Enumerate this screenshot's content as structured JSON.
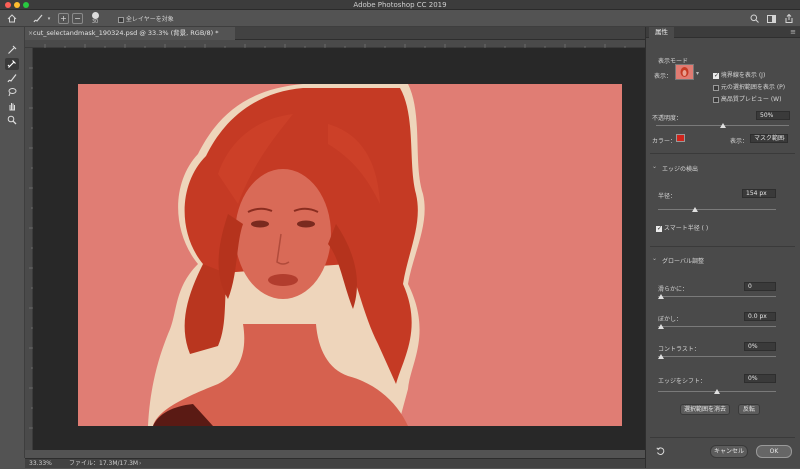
{
  "window": {
    "title": "Adobe Photoshop CC 2019"
  },
  "options_bar": {
    "brush_size": "30",
    "sample_all_layers": "全レイヤーを対象"
  },
  "document_tab": {
    "label": "cut_selectandmask_190324.psd @ 33.3% (背景, RGB/8) *"
  },
  "status_bar": {
    "zoom": "33.33%",
    "file_info": "ファイル：17.3M/17.3M"
  },
  "panel": {
    "tab": "属性",
    "view_mode": {
      "title": "表示モード",
      "view_label": "表示：",
      "show_edge": "境界線を表示 (J)",
      "show_original": "元の選択範囲を表示 (P)",
      "high_quality": "高品質プレビュー (W)"
    },
    "opacity": {
      "label": "不透明度：",
      "value": "50%",
      "level": 0.5
    },
    "color": {
      "label": "カラー：",
      "swatch": "#d0241b"
    },
    "display": {
      "label": "表示：",
      "value": "マスク範囲"
    },
    "edge_detection": {
      "title": "エッジの検出",
      "radius_label": "半径：",
      "radius_value": "154 px",
      "radius_level": 0.31,
      "smart_radius": "スマート半径 ( )"
    },
    "global_refinements": {
      "title": "グローバル調整",
      "smooth_label": "滑らかに：",
      "smooth_value": "0",
      "feather_label": "ぼかし：",
      "feather_value": "0.0 px",
      "contrast_label": "コントラスト：",
      "contrast_value": "0%",
      "shift_edge_label": "エッジをシフト：",
      "shift_edge_value": "0%",
      "shift_edge_level": 0.5,
      "clear_selection": "選択範囲を消去",
      "invert": "反転"
    },
    "footer": {
      "cancel": "キャンセル",
      "ok": "OK"
    }
  },
  "icons": {
    "home": "home-icon",
    "brush": "brush-icon",
    "zoom_in": "plus-icon",
    "zoom_out": "minus-icon",
    "search": "search-icon",
    "workspace": "workspace-icon",
    "share": "share-icon"
  }
}
